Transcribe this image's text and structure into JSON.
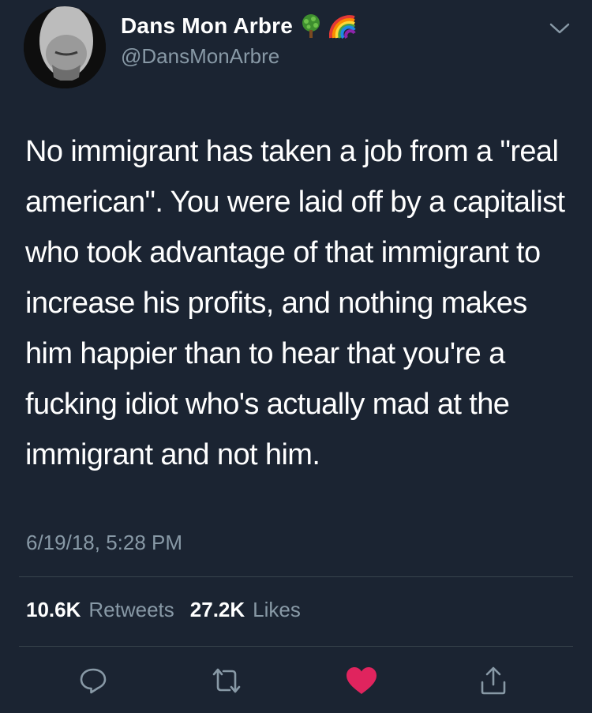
{
  "user": {
    "display_name": "Dans Mon Arbre",
    "handle": "@DansMonArbre",
    "badges": [
      "tree-emoji",
      "rainbow-emoji"
    ]
  },
  "tweet": {
    "text": "No immigrant has taken a job from a \"real american\".  You were laid off by a capitalist who took advantage of that immigrant to increase his profits, and nothing makes him happier than to hear that you're a fucking idiot who's actually mad at the immigrant and not him.",
    "timestamp": "6/19/18, 5:28 PM"
  },
  "stats": {
    "retweets_count": "10.6K",
    "retweets_label": "Retweets",
    "likes_count": "27.2K",
    "likes_label": "Likes"
  },
  "actions": {
    "icons": [
      "reply-icon",
      "retweet-icon",
      "like-icon",
      "share-icon"
    ],
    "liked": true
  },
  "colors": {
    "background": "#1b2432",
    "secondary_text": "#8899a6",
    "divider": "#38444d",
    "like": "#e0245e"
  }
}
